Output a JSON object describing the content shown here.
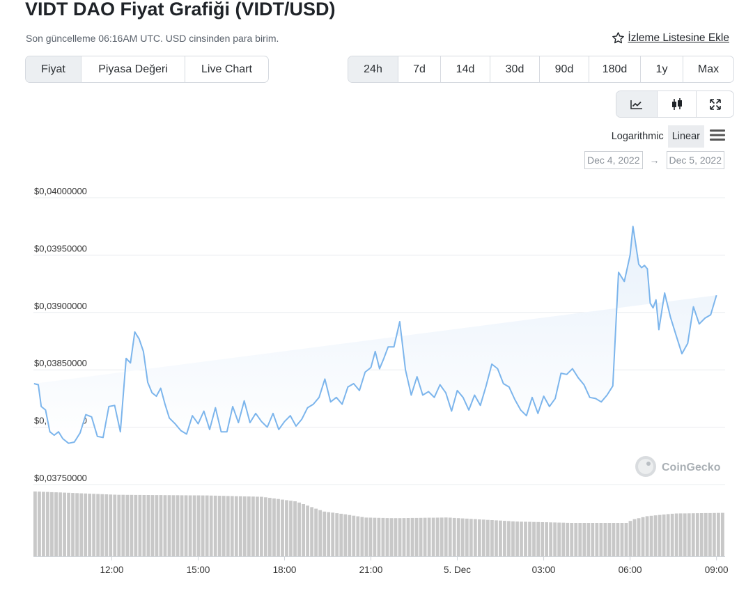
{
  "header": {
    "title": "VIDT DAO Fiyat Grafiği (VIDT/USD)",
    "subtitle": "Son güncelleme 06:16AM UTC. USD cinsinden para birim.",
    "watchlist_label": "İzleme Listesine Ekle"
  },
  "chart_type_tabs": [
    {
      "label": "Fiyat",
      "active": true
    },
    {
      "label": "Piyasa Değeri",
      "active": false
    },
    {
      "label": "Live Chart",
      "active": false
    }
  ],
  "range_tabs": [
    {
      "label": "24h",
      "active": true
    },
    {
      "label": "7d",
      "active": false
    },
    {
      "label": "14d",
      "active": false
    },
    {
      "label": "30d",
      "active": false
    },
    {
      "label": "90d",
      "active": false
    },
    {
      "label": "180d",
      "active": false
    },
    {
      "label": "1y",
      "active": false
    },
    {
      "label": "Max",
      "active": false
    }
  ],
  "view_buttons": [
    {
      "icon": "line-chart-icon",
      "active": true
    },
    {
      "icon": "candlestick-icon",
      "active": false
    },
    {
      "icon": "expand-icon",
      "active": false
    }
  ],
  "scale": {
    "logarithmic_label": "Logarithmic",
    "linear_label": "Linear",
    "selected": "Linear"
  },
  "date_range": {
    "from": "Dec 4, 2022",
    "to": "Dec 5, 2022",
    "arrow": "→"
  },
  "watermark": "CoinGecko",
  "colors": {
    "line": "#7cb5ec",
    "area_top": "#e8f1fb",
    "volume": "#c8c8c8",
    "grid": "#e9ecef",
    "active_tab": "#eceff2"
  },
  "chart_data": {
    "type": "area",
    "title": "",
    "xlabel": "",
    "ylabel": "",
    "y_tick_labels": [
      "$0,03750000",
      "$0,03800000",
      "$0,03850000",
      "$0,03900000",
      "$0,03950000",
      "$0,04000000"
    ],
    "y_ticks": [
      0.0375,
      0.038,
      0.0385,
      0.039,
      0.0395,
      0.04
    ],
    "ylim": [
      0.0375,
      0.04
    ],
    "x_tick_labels": [
      "12:00",
      "15:00",
      "18:00",
      "21:00",
      "5. Dec",
      "03:00",
      "06:00",
      "09:00"
    ],
    "x_ticks_hours": [
      12,
      15,
      18,
      21,
      24,
      27,
      30,
      33
    ],
    "xlim_hours": [
      9.28,
      33.3
    ],
    "grid": true,
    "series": [
      {
        "values_hours": [
          9.3,
          9.45,
          9.55,
          9.7,
          9.85,
          10.0,
          10.15,
          10.3,
          10.5,
          10.7,
          10.9,
          11.1,
          11.3,
          11.5,
          11.7,
          11.9,
          12.1,
          12.3,
          12.5,
          12.65,
          12.8,
          12.95,
          13.1,
          13.25,
          13.4,
          13.55,
          13.7,
          13.85,
          14.0,
          14.2,
          14.4,
          14.6,
          14.8,
          15.0,
          15.2,
          15.4,
          15.6,
          15.8,
          16.0,
          16.2,
          16.4,
          16.6,
          16.8,
          17.0,
          17.2,
          17.4,
          17.6,
          17.8,
          18.0,
          18.2,
          18.4,
          18.6,
          18.8,
          19.0,
          19.2,
          19.4,
          19.6,
          19.8,
          20.0,
          20.2,
          20.4,
          20.6,
          20.8,
          21.0,
          21.15,
          21.3,
          21.45,
          21.6,
          21.8,
          22.0,
          22.2,
          22.4,
          22.6,
          22.8,
          23.0,
          23.2,
          23.4,
          23.6,
          23.8,
          24.0,
          24.2,
          24.4,
          24.6,
          24.8,
          25.0,
          25.2,
          25.4,
          25.6,
          25.8,
          26.0,
          26.2,
          26.4,
          26.6,
          26.8,
          27.0,
          27.2,
          27.4,
          27.6,
          27.8,
          28.0,
          28.2,
          28.4,
          28.6,
          28.8,
          29.0,
          29.2,
          29.4,
          29.6,
          29.8,
          30.0,
          30.1,
          30.2,
          30.3,
          30.4,
          30.5,
          30.6,
          30.7,
          30.8,
          30.9,
          31.0,
          31.2,
          31.4,
          31.6,
          31.8,
          32.0,
          32.2,
          32.4,
          32.6,
          32.8,
          33.0,
          33.15,
          33.28
        ],
        "values": [
          0.03838,
          0.03837,
          0.03818,
          0.03815,
          0.03796,
          0.03793,
          0.03796,
          0.0379,
          0.03786,
          0.03787,
          0.03795,
          0.03811,
          0.03809,
          0.03792,
          0.03791,
          0.03818,
          0.03819,
          0.03796,
          0.0386,
          0.03856,
          0.03883,
          0.03877,
          0.03866,
          0.03839,
          0.0383,
          0.03827,
          0.03834,
          0.0382,
          0.03808,
          0.03803,
          0.03797,
          0.03794,
          0.0381,
          0.03803,
          0.03814,
          0.03798,
          0.03817,
          0.03796,
          0.03796,
          0.03818,
          0.03804,
          0.03823,
          0.03804,
          0.03812,
          0.03805,
          0.038,
          0.03812,
          0.03798,
          0.03805,
          0.0381,
          0.03801,
          0.03807,
          0.03817,
          0.0382,
          0.03826,
          0.03842,
          0.03822,
          0.03826,
          0.0382,
          0.03835,
          0.03838,
          0.03832,
          0.03848,
          0.03852,
          0.03866,
          0.03851,
          0.0386,
          0.0387,
          0.0387,
          0.03892,
          0.0385,
          0.03828,
          0.03844,
          0.03828,
          0.03831,
          0.03826,
          0.03837,
          0.0383,
          0.03814,
          0.03832,
          0.03826,
          0.03815,
          0.03828,
          0.03819,
          0.03836,
          0.03855,
          0.03851,
          0.03838,
          0.03835,
          0.03824,
          0.03815,
          0.0381,
          0.03826,
          0.03812,
          0.03827,
          0.03818,
          0.03825,
          0.03847,
          0.03846,
          0.03851,
          0.03843,
          0.03837,
          0.03826,
          0.03825,
          0.03822,
          0.03828,
          0.03836,
          0.03935,
          0.03927,
          0.0395,
          0.03975,
          0.03959,
          0.03942,
          0.03939,
          0.03941,
          0.03938,
          0.03908,
          0.03904,
          0.03911,
          0.03885,
          0.03917,
          0.03896,
          0.0388,
          0.03864,
          0.03873,
          0.03905,
          0.0389,
          0.03895,
          0.03898,
          0.03915
        ]
      }
    ],
    "volume_bar_count": 165,
    "volume_relative": [
      [
        0.0,
        0.97
      ],
      [
        0.12,
        0.92
      ],
      [
        0.25,
        0.91
      ],
      [
        0.33,
        0.89
      ],
      [
        0.38,
        0.82
      ],
      [
        0.42,
        0.67
      ],
      [
        0.45,
        0.63
      ],
      [
        0.48,
        0.58
      ],
      [
        0.52,
        0.57
      ],
      [
        0.6,
        0.58
      ],
      [
        0.7,
        0.52
      ],
      [
        0.78,
        0.5
      ],
      [
        0.86,
        0.5
      ],
      [
        0.87,
        0.55
      ],
      [
        0.89,
        0.6
      ],
      [
        0.93,
        0.64
      ],
      [
        1.0,
        0.65
      ]
    ]
  }
}
